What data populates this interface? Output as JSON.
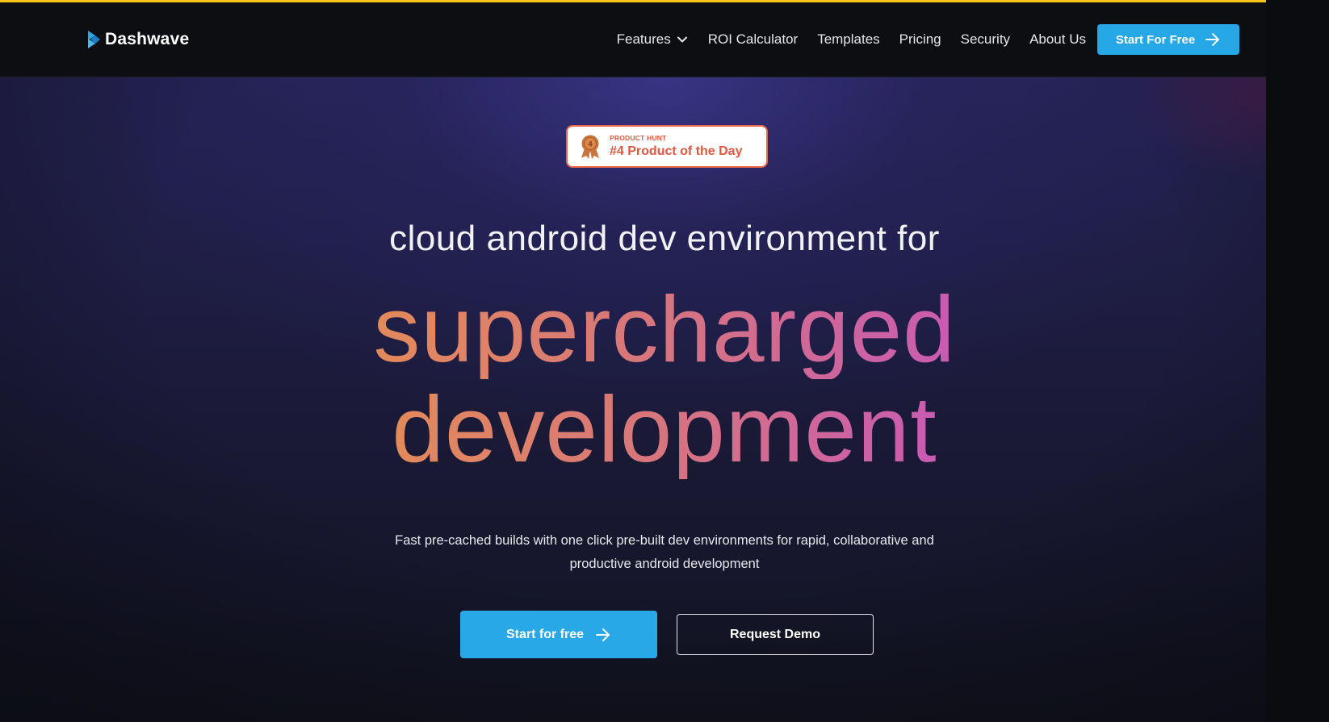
{
  "brand": {
    "name": "Dashwave",
    "accent_color": "#27a8e6",
    "top_bar_color": "#f5c518"
  },
  "nav": {
    "items": [
      {
        "label": "Features",
        "has_dropdown": true
      },
      {
        "label": "ROI Calculator"
      },
      {
        "label": "Templates"
      },
      {
        "label": "Pricing"
      },
      {
        "label": "Security"
      },
      {
        "label": "About Us"
      }
    ],
    "cta_label": "Start For Free"
  },
  "badge": {
    "small_label": "PRODUCT HUNT",
    "title": "#4 Product of the Day",
    "rank": "4",
    "color": "#e0573f"
  },
  "hero": {
    "subtitle": "cloud android dev environment for",
    "title_lines": [
      "supercharged",
      "development"
    ],
    "gradient_colors": [
      "#e38a5a",
      "#c85bb2"
    ],
    "description_lines": [
      "Fast pre-cached builds with one click pre-built dev environments for rapid, collaborative and",
      "productive android development"
    ],
    "primary_cta": "Start for free",
    "secondary_cta": "Request Demo"
  },
  "icons": {
    "logo": "dashwave-logo-icon",
    "dropdown": "chevron-down-icon",
    "arrow": "arrow-right-icon",
    "medal": "medal-icon"
  }
}
